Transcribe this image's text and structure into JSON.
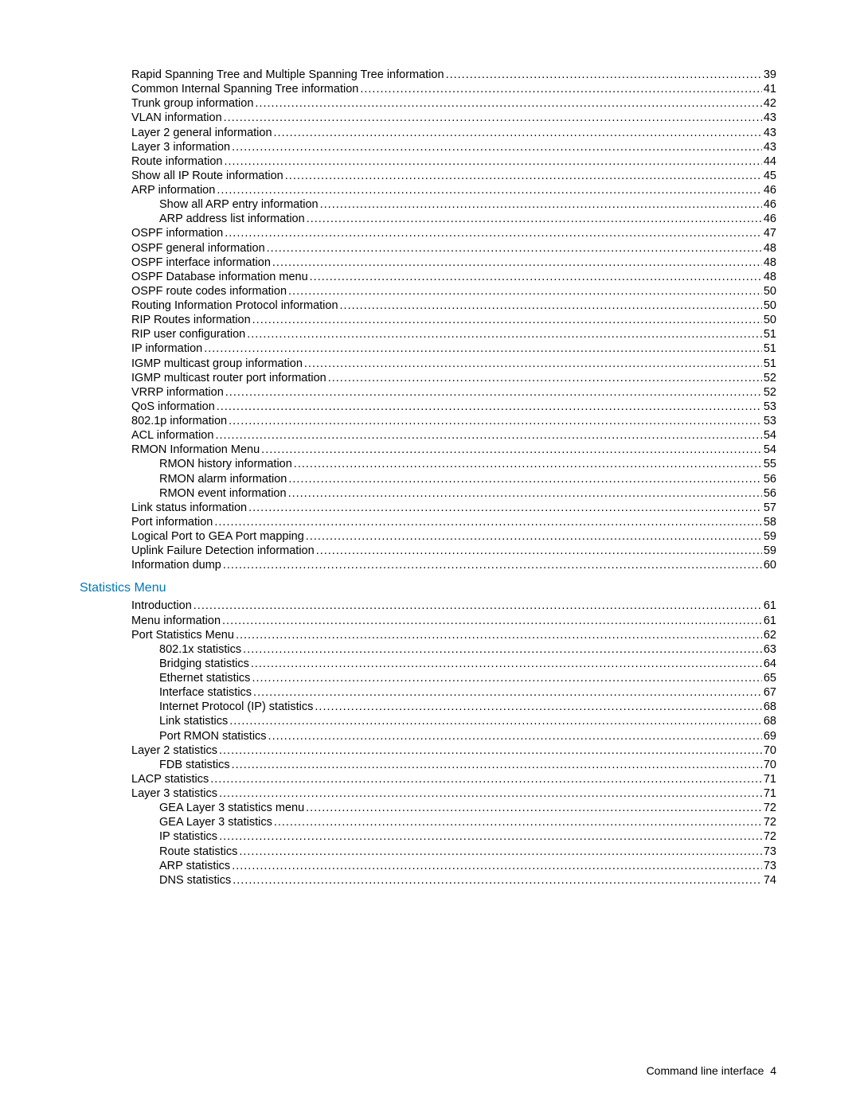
{
  "footer": {
    "text": "Command line interface",
    "page": "4"
  },
  "sections": [
    {
      "heading": null,
      "entries": [
        {
          "level": 2,
          "label": "Rapid Spanning Tree and Multiple Spanning Tree information",
          "page": "39"
        },
        {
          "level": 2,
          "label": "Common Internal Spanning Tree information",
          "page": "41"
        },
        {
          "level": 2,
          "label": "Trunk group information",
          "page": "42"
        },
        {
          "level": 2,
          "label": "VLAN information",
          "page": "43"
        },
        {
          "level": 2,
          "label": "Layer 2 general information",
          "page": "43"
        },
        {
          "level": 2,
          "label": "Layer 3 information",
          "page": "43"
        },
        {
          "level": 2,
          "label": "Route information",
          "page": "44"
        },
        {
          "level": 2,
          "label": "Show all IP Route information",
          "page": "45"
        },
        {
          "level": 2,
          "label": "ARP information",
          "page": "46"
        },
        {
          "level": 3,
          "label": "Show all ARP entry information",
          "page": "46"
        },
        {
          "level": 3,
          "label": "ARP address list information",
          "page": "46"
        },
        {
          "level": 2,
          "label": "OSPF information",
          "page": "47"
        },
        {
          "level": 2,
          "label": "OSPF general information",
          "page": "48"
        },
        {
          "level": 2,
          "label": "OSPF interface information",
          "page": "48"
        },
        {
          "level": 2,
          "label": "OSPF Database information menu",
          "page": "48"
        },
        {
          "level": 2,
          "label": "OSPF route codes information",
          "page": "50"
        },
        {
          "level": 2,
          "label": "Routing Information Protocol information",
          "page": "50"
        },
        {
          "level": 2,
          "label": "RIP Routes information",
          "page": "50"
        },
        {
          "level": 2,
          "label": "RIP user configuration",
          "page": "51"
        },
        {
          "level": 2,
          "label": "IP information",
          "page": "51"
        },
        {
          "level": 2,
          "label": "IGMP multicast group information",
          "page": "51"
        },
        {
          "level": 2,
          "label": "IGMP multicast router port information",
          "page": "52"
        },
        {
          "level": 2,
          "label": "VRRP information",
          "page": "52"
        },
        {
          "level": 2,
          "label": "QoS information",
          "page": "53"
        },
        {
          "level": 2,
          "label": "802.1p information",
          "page": "53"
        },
        {
          "level": 2,
          "label": "ACL information",
          "page": "54"
        },
        {
          "level": 2,
          "label": "RMON Information Menu",
          "page": "54"
        },
        {
          "level": 3,
          "label": "RMON history information",
          "page": "55"
        },
        {
          "level": 3,
          "label": "RMON alarm information",
          "page": "56"
        },
        {
          "level": 3,
          "label": "RMON event information",
          "page": "56"
        },
        {
          "level": 2,
          "label": "Link status information",
          "page": "57"
        },
        {
          "level": 2,
          "label": "Port information",
          "page": "58"
        },
        {
          "level": 2,
          "label": "Logical Port to GEA Port mapping",
          "page": "59"
        },
        {
          "level": 2,
          "label": "Uplink Failure Detection information",
          "page": "59"
        },
        {
          "level": 2,
          "label": "Information dump",
          "page": "60"
        }
      ]
    },
    {
      "heading": "Statistics Menu",
      "entries": [
        {
          "level": 2,
          "label": "Introduction",
          "page": "61"
        },
        {
          "level": 2,
          "label": "Menu information",
          "page": "61"
        },
        {
          "level": 2,
          "label": "Port Statistics Menu",
          "page": "62"
        },
        {
          "level": 3,
          "label": "802.1x statistics",
          "page": "63"
        },
        {
          "level": 3,
          "label": "Bridging statistics",
          "page": "64"
        },
        {
          "level": 3,
          "label": "Ethernet statistics",
          "page": "65"
        },
        {
          "level": 3,
          "label": "Interface statistics",
          "page": "67"
        },
        {
          "level": 3,
          "label": "Internet Protocol (IP) statistics",
          "page": "68"
        },
        {
          "level": 3,
          "label": "Link statistics",
          "page": "68"
        },
        {
          "level": 3,
          "label": "Port RMON statistics",
          "page": "69"
        },
        {
          "level": 2,
          "label": "Layer 2 statistics",
          "page": "70"
        },
        {
          "level": 3,
          "label": "FDB statistics",
          "page": "70"
        },
        {
          "level": 2,
          "label": "LACP statistics",
          "page": "71"
        },
        {
          "level": 2,
          "label": "Layer 3 statistics",
          "page": "71"
        },
        {
          "level": 3,
          "label": "GEA Layer 3 statistics menu",
          "page": "72"
        },
        {
          "level": 3,
          "label": "GEA Layer 3 statistics",
          "page": "72"
        },
        {
          "level": 3,
          "label": "IP statistics",
          "page": "72"
        },
        {
          "level": 3,
          "label": "Route statistics",
          "page": "73"
        },
        {
          "level": 3,
          "label": "ARP statistics",
          "page": "73"
        },
        {
          "level": 3,
          "label": "DNS statistics",
          "page": "74"
        }
      ]
    }
  ]
}
